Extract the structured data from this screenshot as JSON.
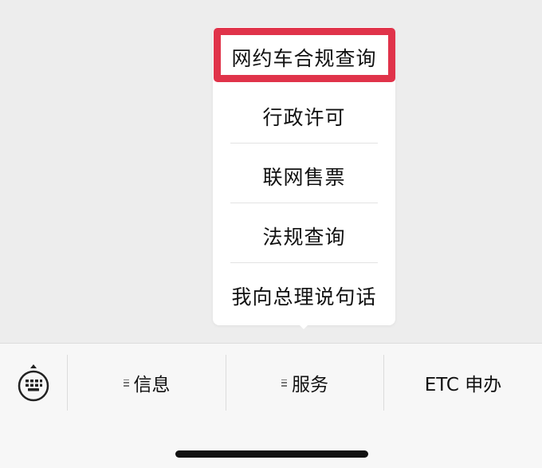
{
  "popup_menu": {
    "items": [
      {
        "label": "网约车合规查询"
      },
      {
        "label": "行政许可"
      },
      {
        "label": "联网售票"
      },
      {
        "label": "法规查询"
      },
      {
        "label": "我向总理说句话"
      }
    ]
  },
  "bottom_menu": {
    "keyboard_icon": "keyboard-icon",
    "tabs": [
      {
        "label": "信息"
      },
      {
        "label": "服务"
      },
      {
        "label": "ETC 申办"
      }
    ]
  },
  "colors": {
    "highlight": "#e0334a",
    "background": "#ededed",
    "menu_bg": "#ffffff",
    "bar_bg": "#f7f7f7"
  }
}
